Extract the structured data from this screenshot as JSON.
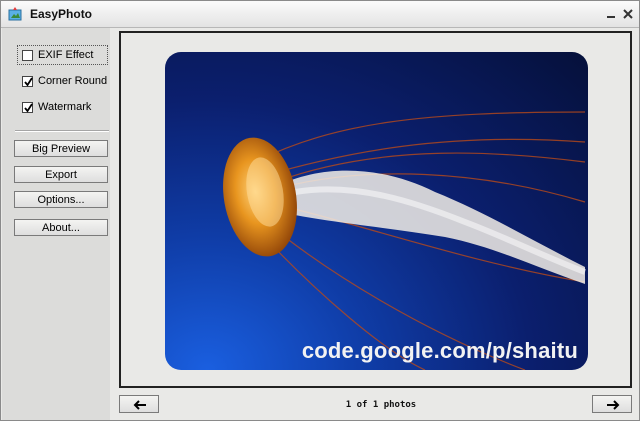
{
  "window": {
    "title": "EasyPhoto"
  },
  "sidebar": {
    "options": [
      {
        "label": "EXIF Effect",
        "checked": false
      },
      {
        "label": "Corner Round",
        "checked": true
      },
      {
        "label": "Watermark",
        "checked": true
      }
    ],
    "buttons": [
      "Big Preview",
      "Export",
      "Options...",
      "About..."
    ]
  },
  "preview": {
    "watermark_text": "code.google.com/p/shaitu",
    "photo_subject": "jellyfish"
  },
  "footer": {
    "status": "1 of 1 photos",
    "prev_icon": "arrow-left-icon",
    "next_icon": "arrow-right-icon"
  },
  "colors": {
    "window_bg": "#e9e9e7",
    "photo_bg": "#0b1f6e",
    "jellyfish": "#e8951f"
  }
}
